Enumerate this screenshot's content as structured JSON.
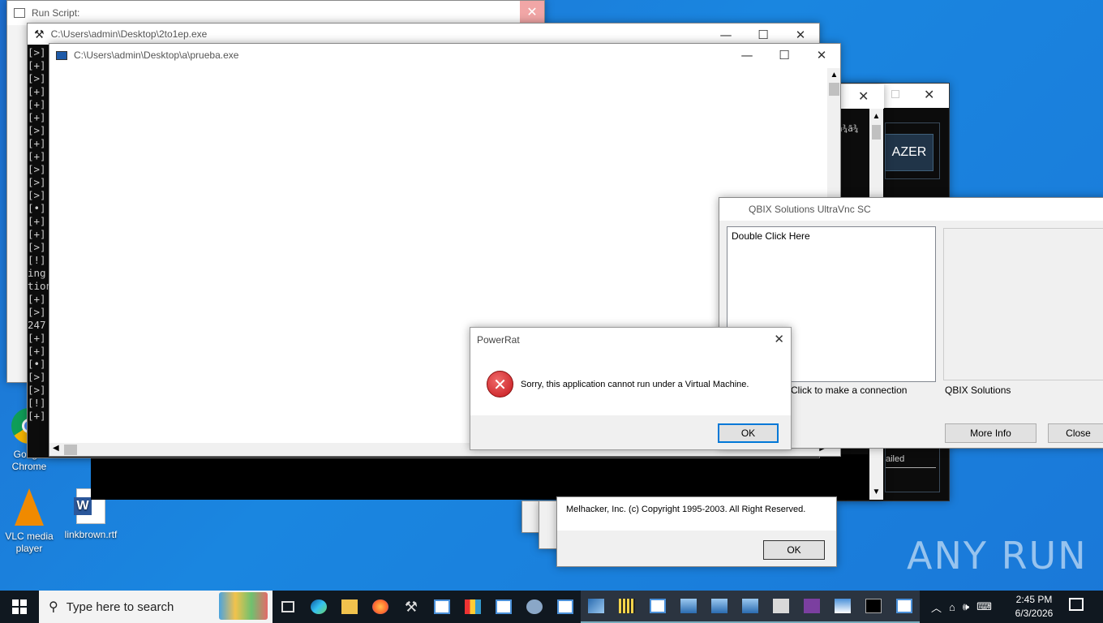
{
  "desktop": {
    "icons": [
      {
        "label": "Google Chrome"
      },
      {
        "label": "VLC media player"
      },
      {
        "label": "linkbrown.rtf"
      }
    ],
    "watermark": "ANY RUN"
  },
  "run_script": {
    "title": "Run Script:"
  },
  "window_2to1ep": {
    "title": "C:\\Users\\admin\\Desktop\\2to1ep.exe"
  },
  "window_prueba": {
    "title": "C:\\Users\\admin\\Desktop\\a\\prueba.exe"
  },
  "console_lines": "[>]\n[+]\n[>]\n[+]\n[+]\n[+]\n[>]\n[+]\n[+]\n[>]\n[>]\n[>]\n[•]\n[+]\n[+]\n[>]\n[!]\ning\ntion\n[+]\n[>]\n247\n[+]\n[+]\n[•]\n[>]\n[>]\n[!]\n[+]",
  "blazer": {
    "garbled_text": "ã¾ã¾",
    "button_fragment": "AZER",
    "status_fragment": "ailed"
  },
  "vnc": {
    "title": "QBIX Solutions UltraVnc SC",
    "list_text": "Double Click Here",
    "hint": "e Click to make a connection",
    "brand": "QBIX Solutions",
    "more_info": "More Info",
    "close": "Close"
  },
  "powerrat": {
    "title": "PowerRat",
    "message": "Sorry, this application cannot run under a Virtual Machine.",
    "ok": "OK"
  },
  "melhacker": {
    "copyright": "Melhacker, Inc. (c) Copyright 1995-2003. All Right Reserved.",
    "ok": "OK"
  },
  "taskbar": {
    "search_placeholder": "Type here to search",
    "time": "2:45 PM",
    "date": "6/3/2026"
  },
  "colors": {
    "accent": "#0078d7",
    "error": "#d6262d",
    "taskbar": "#101820"
  }
}
